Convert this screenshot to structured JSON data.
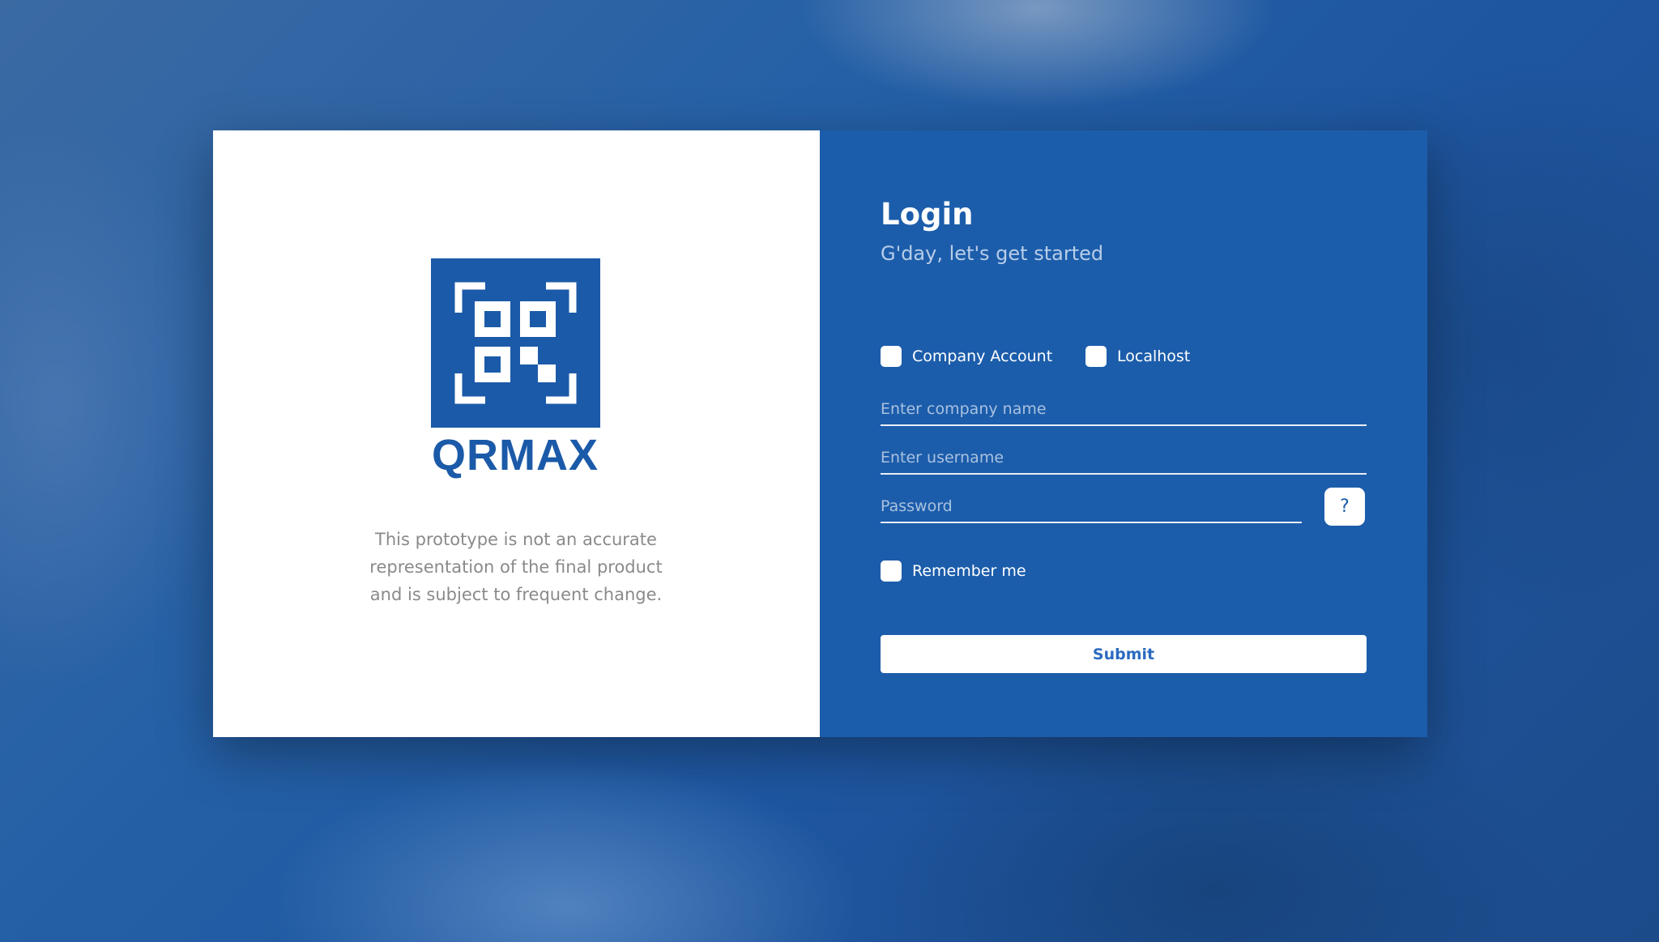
{
  "brand": {
    "name": "QRMAX",
    "logo_icon": "qr-code-icon",
    "color": "#1b5aa8"
  },
  "disclaimer": "This prototype is not an accurate representation of the final product and is subject to frequent change.",
  "login": {
    "title": "Login",
    "subtitle": "G'day, let's get started",
    "company_account_label": "Company Account",
    "localhost_label": "Localhost",
    "company_placeholder": "Enter company name",
    "username_placeholder": "Enter username",
    "password_placeholder": "Password",
    "help_label": "?",
    "remember_label": "Remember me",
    "submit_label": "Submit",
    "panel_color": "#1c5dab"
  }
}
